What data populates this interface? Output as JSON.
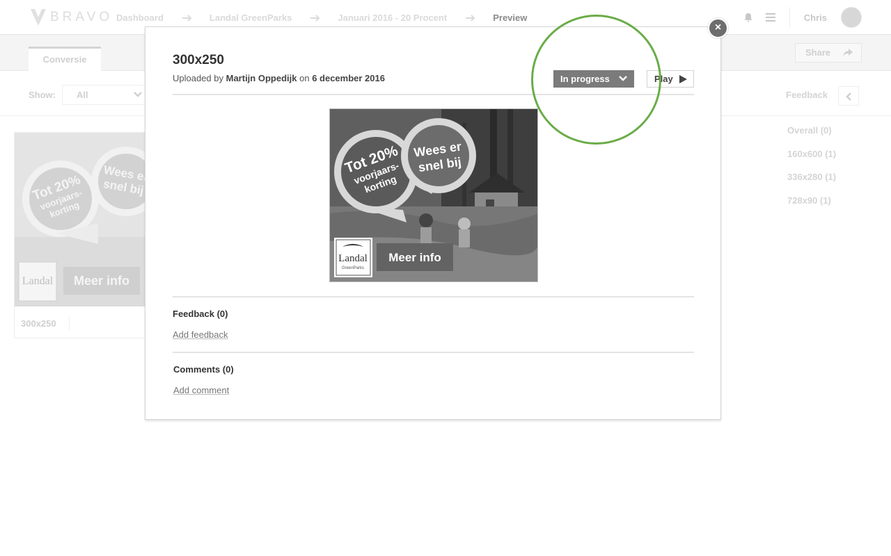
{
  "app": {
    "logo_text": "BRAVO",
    "breadcrumbs": [
      "Dashboard",
      "Landal GreenParks",
      "Januari 2016 - 20 Procent",
      "Preview"
    ],
    "user_name": "Chris"
  },
  "subbar": {
    "tab_label": "Conversie",
    "share_label": "Share"
  },
  "filter": {
    "show_label": "Show:",
    "show_value": "All",
    "feedback_label": "Feedback"
  },
  "card": {
    "name": "300x250",
    "badge_line1": "Tot 20%",
    "badge_line2": "voorjaars-",
    "badge_line3": "korting",
    "bubble_line1": "Wees er",
    "bubble_line2": "snel bij",
    "logo": "Landal",
    "cta": "Meer info"
  },
  "feedback_list": [
    "Overall (0)",
    "160x600 (1)",
    "336x280 (1)",
    "728x90 (1)"
  ],
  "modal": {
    "close_symbol": "×",
    "title": "300x250",
    "uploaded_prefix": "Uploaded by",
    "uploader": "Martijn Oppedijk",
    "on_word": "on",
    "date": "6 december 2016",
    "status_label": "In progress",
    "play_label": "Play",
    "feedback_title": "Feedback (0)",
    "add_feedback": "Add feedback",
    "comments_title": "Comments (0)",
    "add_comment": "Add comment"
  },
  "banner": {
    "badge_line1": "Tot 20%",
    "badge_line2": "voorjaars-",
    "badge_line3": "korting",
    "bubble_line1": "Wees er",
    "bubble_line2": "snel bij",
    "logo": "Landal",
    "logo_sub": "GreenParks",
    "cta": "Meer info"
  },
  "colors": {
    "highlight": "#6aac47",
    "status_button": "#7b7b7b",
    "close_button": "#6d6d6d"
  }
}
